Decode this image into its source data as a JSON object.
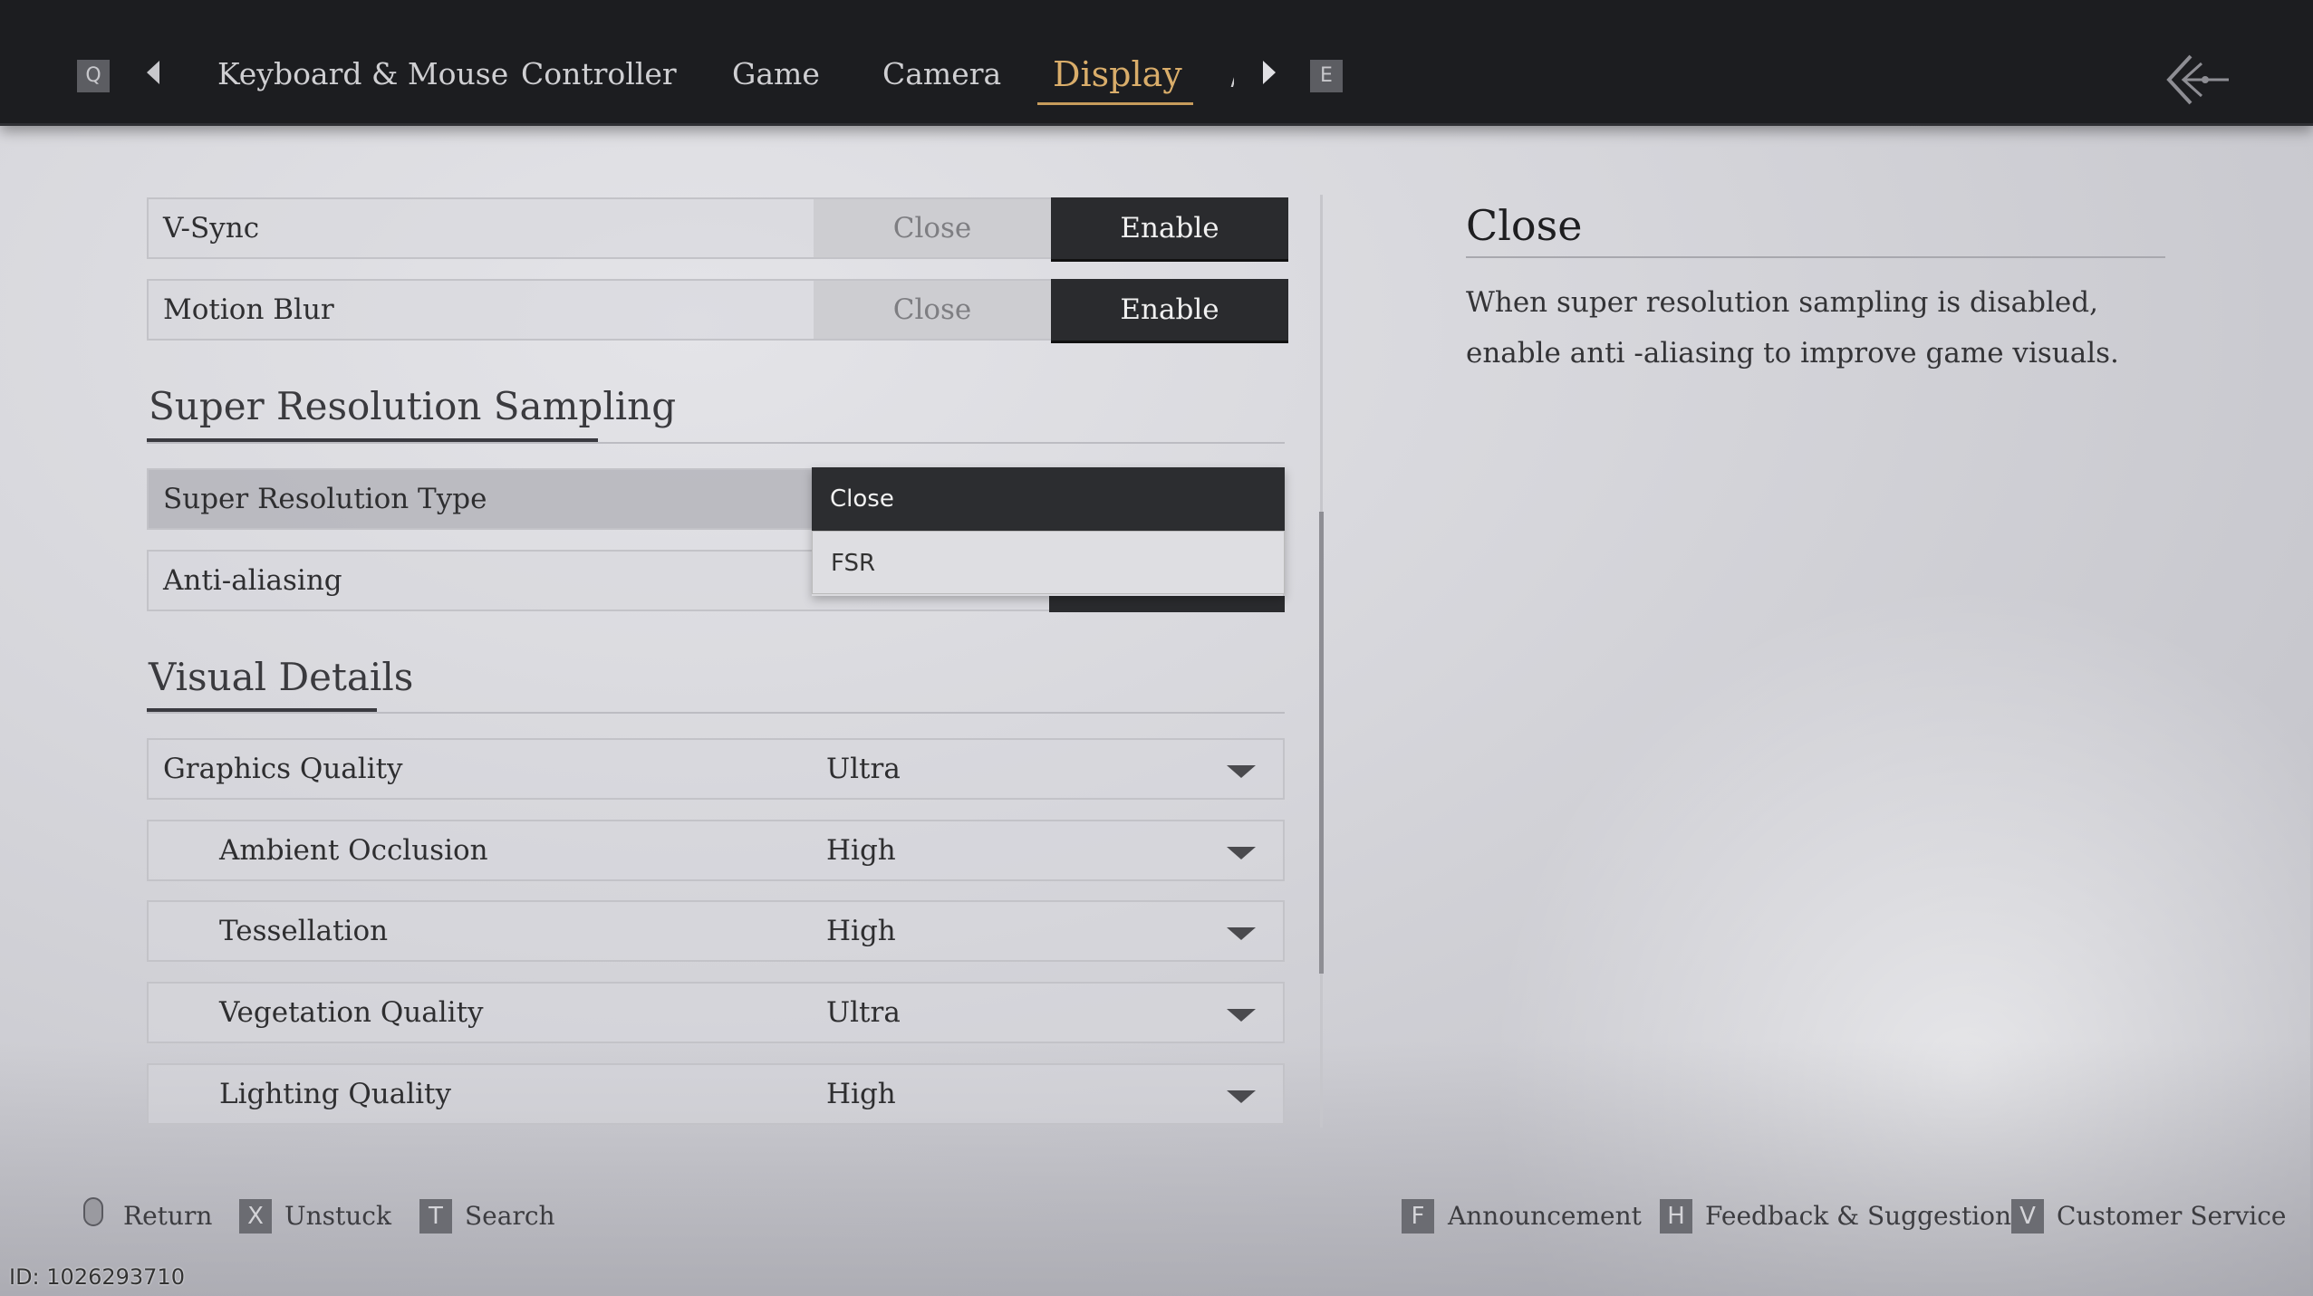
{
  "nav": {
    "prev_key": "Q",
    "next_key": "E",
    "tabs": [
      "Keyboard & Mouse",
      "Controller",
      "Game",
      "Camera",
      "Display"
    ],
    "active_tab": "Display"
  },
  "settings": {
    "vsync": {
      "label": "V-Sync",
      "off": "Close",
      "on": "Enable",
      "value": "Enable"
    },
    "motion_blur": {
      "label": "Motion Blur",
      "off": "Close",
      "on": "Enable",
      "value": "Enable"
    },
    "section_srs": "Super Resolution Sampling",
    "sr_type": {
      "label": "Super Resolution Type",
      "options": [
        "Close",
        "FSR"
      ],
      "selected": "Close"
    },
    "anti_aliasing": {
      "label": "Anti-aliasing"
    },
    "section_visual": "Visual Details",
    "graphics_quality": {
      "label": "Graphics Quality",
      "value": "Ultra"
    },
    "ambient_occlusion": {
      "label": "Ambient Occlusion",
      "value": "High"
    },
    "tessellation": {
      "label": "Tessellation",
      "value": "High"
    },
    "vegetation_quality": {
      "label": "Vegetation Quality",
      "value": "Ultra"
    },
    "lighting_quality": {
      "label": "Lighting Quality",
      "value": "High"
    }
  },
  "description": {
    "title": "Close",
    "text": "When super resolution sampling is disabled, enable anti -aliasing to improve game visuals."
  },
  "footer": {
    "return": "Return",
    "unstuck_key": "X",
    "unstuck": "Unstuck",
    "search_key": "T",
    "search": "Search",
    "announcement_key": "F",
    "announcement": "Announcement",
    "feedback_key": "H",
    "feedback": "Feedback & Suggestions",
    "service_key": "V",
    "service": "Customer Service"
  },
  "uid": "ID: 1026293710",
  "colors": {
    "accent": "#d9ad6a",
    "topbar": "#1c1d20",
    "enable_bg": "#2a2b2e"
  }
}
